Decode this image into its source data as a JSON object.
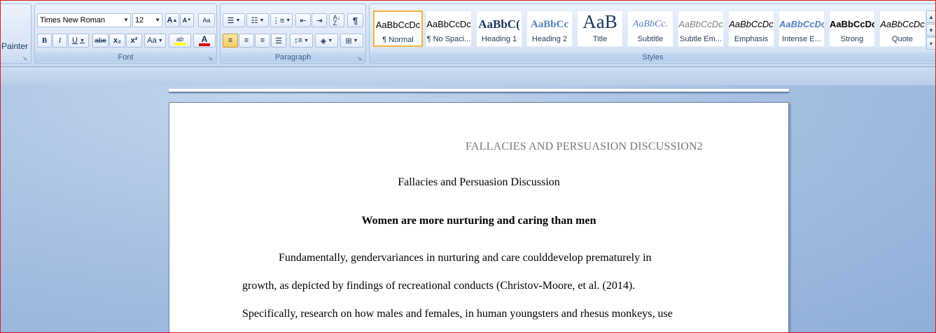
{
  "ribbon": {
    "clipboard": {
      "format_painter_label": "Painter"
    },
    "font": {
      "group_label": "Font",
      "font_name": "Times New Roman",
      "font_size": "12",
      "grow_label": "A",
      "shrink_label": "A",
      "clear_label": "Aa",
      "bold_label": "B",
      "italic_label": "I",
      "underline_label": "U",
      "strike_label": "abe",
      "subscript_label": "x₂",
      "superscript_label": "x²",
      "case_label": "Aa",
      "highlight_label": "ab",
      "font_color_label": "A",
      "highlight_color": "#ffff00",
      "font_color": "#e00000"
    },
    "paragraph": {
      "group_label": "Paragraph",
      "pilcrow": "¶"
    },
    "styles": {
      "group_label": "Styles",
      "items": [
        {
          "sample": "AaBbCcDc",
          "name": "¶ Normal"
        },
        {
          "sample": "AaBbCcDc",
          "name": "¶ No Spaci..."
        },
        {
          "sample": "AaBbC(",
          "name": "Heading 1"
        },
        {
          "sample": "AaBbCc",
          "name": "Heading 2"
        },
        {
          "sample": "AaB",
          "name": "Title"
        },
        {
          "sample": "AaBbCc.",
          "name": "Subtitle"
        },
        {
          "sample": "AaBbCcDc",
          "name": "Subtle Em..."
        },
        {
          "sample": "AaBbCcDc",
          "name": "Emphasis"
        },
        {
          "sample": "AaBbCcDc",
          "name": "Intense E..."
        },
        {
          "sample": "AaBbCcDc",
          "name": "Strong"
        },
        {
          "sample": "AaBbCcDc",
          "name": "Quote"
        }
      ]
    }
  },
  "document": {
    "header": "FALLACIES  AND  PERSUASION  DISCUSSION2",
    "title": "Fallacies and Persuasion Discussion",
    "subtitle": "Women are more nurturing and caring than men",
    "lines": [
      "Fundamentally, gendervariances in nurturing and care coulddevelop prematurely in",
      "growth, as depicted by findings of recreational conducts (Christov-Moore, et al. (2014).",
      "Specifically, research on how males and females, in human youngsters and rhesus monkeys, use"
    ]
  }
}
